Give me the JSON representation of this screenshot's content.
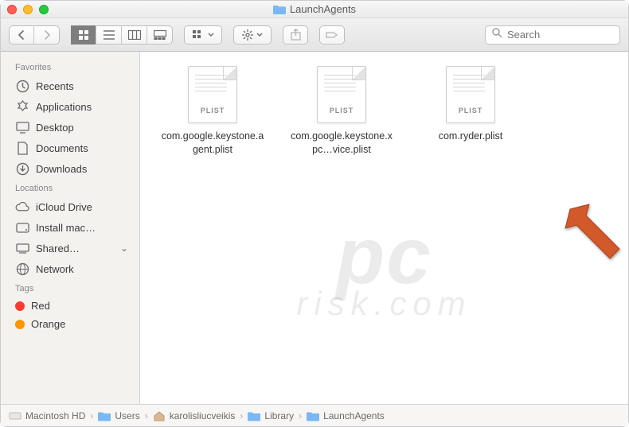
{
  "window": {
    "title": "LaunchAgents"
  },
  "toolbar": {
    "search_placeholder": "Search"
  },
  "sidebar": {
    "sections": [
      {
        "label": "Favorites",
        "items": [
          {
            "icon": "clock-icon",
            "label": "Recents"
          },
          {
            "icon": "apps-icon",
            "label": "Applications"
          },
          {
            "icon": "desktop-icon",
            "label": "Desktop"
          },
          {
            "icon": "documents-icon",
            "label": "Documents"
          },
          {
            "icon": "downloads-icon",
            "label": "Downloads"
          }
        ]
      },
      {
        "label": "Locations",
        "items": [
          {
            "icon": "icloud-icon",
            "label": "iCloud Drive"
          },
          {
            "icon": "disk-icon",
            "label": "Install mac…"
          },
          {
            "icon": "computer-icon",
            "label": "Shared…",
            "disclosure": true
          },
          {
            "icon": "globe-icon",
            "label": "Network"
          }
        ]
      },
      {
        "label": "Tags",
        "items": [
          {
            "icon": "tag-red",
            "label": "Red"
          },
          {
            "icon": "tag-orange",
            "label": "Orange"
          }
        ]
      }
    ]
  },
  "files": [
    {
      "name": "com.google.keystone.agent.plist",
      "badge": "PLIST"
    },
    {
      "name": "com.google.keystone.xpc…vice.plist",
      "badge": "PLIST"
    },
    {
      "name": "com.ryder.plist",
      "badge": "PLIST"
    }
  ],
  "path": [
    {
      "icon": "hdd",
      "label": "Macintosh HD"
    },
    {
      "icon": "folder",
      "label": "Users"
    },
    {
      "icon": "home",
      "label": "karolisliucveikis"
    },
    {
      "icon": "folder",
      "label": "Library"
    },
    {
      "icon": "folder",
      "label": "LaunchAgents"
    }
  ],
  "watermark": {
    "top": "pc",
    "bottom": "risk.com"
  }
}
